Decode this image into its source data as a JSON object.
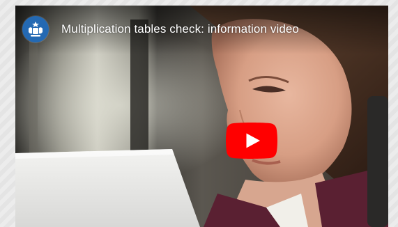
{
  "video": {
    "title": "Multiplication tables check: information video",
    "channel_icon": "royal-coat-of-arms-icon",
    "play_icon": "youtube-play-icon"
  },
  "colors": {
    "play_button_red": "#ff0000",
    "channel_avatar_blue": "#2469b3",
    "title_text": "#ffffff"
  }
}
